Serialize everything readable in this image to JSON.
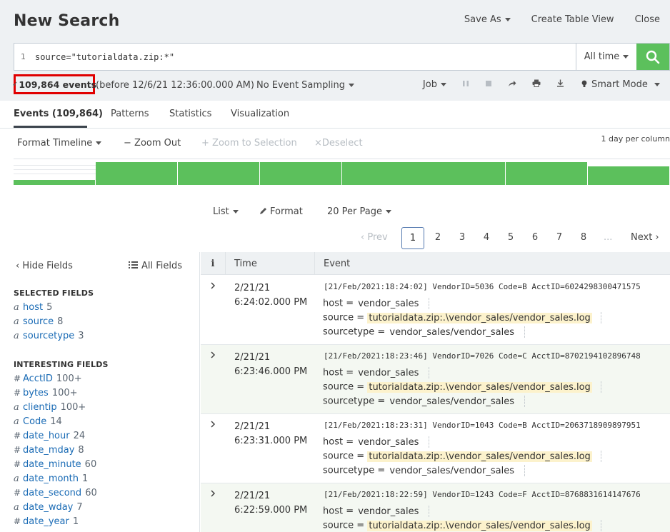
{
  "header": {
    "title": "New Search",
    "save_as": "Save As",
    "create_table_view": "Create Table View",
    "close": "Close"
  },
  "search": {
    "line_number": "1",
    "query": "source=\"tutorialdata.zip:*\"",
    "time_range": "All time"
  },
  "status": {
    "events_count": "109,864 events",
    "before": "(before 12/6/21 12:36:00.000 AM)",
    "sampling": "No Event Sampling",
    "job": "Job",
    "mode": "Smart Mode"
  },
  "tabs": {
    "events": "Events (109,864)",
    "patterns": "Patterns",
    "statistics": "Statistics",
    "visualization": "Visualization"
  },
  "timeline": {
    "format": "Format Timeline",
    "zoom_out": "Zoom Out",
    "zoom_selection": "Zoom to Selection",
    "deselect": "Deselect",
    "scale": "1 day per column",
    "bar_levels": [
      0.2,
      0.95,
      0.95,
      0.95,
      0.95,
      0.95,
      0.95,
      0.75
    ],
    "bar_color": "#5cc05c"
  },
  "list_controls": {
    "list": "List",
    "format": "Format",
    "per_page": "20 Per Page"
  },
  "pager": {
    "prev": "Prev",
    "pages": [
      "1",
      "2",
      "3",
      "4",
      "5",
      "6",
      "7",
      "8"
    ],
    "ellipsis": "...",
    "next": "Next"
  },
  "sidebar": {
    "hide_fields": "Hide Fields",
    "all_fields": "All Fields",
    "selected_heading": "SELECTED FIELDS",
    "selected": [
      {
        "type": "a",
        "name": "host",
        "count": "5"
      },
      {
        "type": "a",
        "name": "source",
        "count": "8"
      },
      {
        "type": "a",
        "name": "sourcetype",
        "count": "3"
      }
    ],
    "interesting_heading": "INTERESTING FIELDS",
    "interesting": [
      {
        "type": "#",
        "name": "AcctID",
        "count": "100+"
      },
      {
        "type": "#",
        "name": "bytes",
        "count": "100+"
      },
      {
        "type": "a",
        "name": "clientip",
        "count": "100+"
      },
      {
        "type": "a",
        "name": "Code",
        "count": "14"
      },
      {
        "type": "#",
        "name": "date_hour",
        "count": "24"
      },
      {
        "type": "#",
        "name": "date_mday",
        "count": "8"
      },
      {
        "type": "#",
        "name": "date_minute",
        "count": "60"
      },
      {
        "type": "a",
        "name": "date_month",
        "count": "1"
      },
      {
        "type": "#",
        "name": "date_second",
        "count": "60"
      },
      {
        "type": "a",
        "name": "date_wday",
        "count": "7"
      },
      {
        "type": "#",
        "name": "date_year",
        "count": "1"
      }
    ]
  },
  "table": {
    "col_info": "i",
    "col_time": "Time",
    "col_event": "Event"
  },
  "events": [
    {
      "date": "2/21/21",
      "time": "6:24:02.000 PM",
      "raw": "[21/Feb/2021:18:24:02] VendorID=5036 Code=B AcctID=6024298300471575",
      "host_label": "host =",
      "host": "vendor_sales",
      "source_label": "source =",
      "source": "tutorialdata.zip:.\\vendor_sales/vendor_sales.log",
      "sourcetype_label": "sourcetype =",
      "sourcetype": "vendor_sales/vendor_sales"
    },
    {
      "date": "2/21/21",
      "time": "6:23:46.000 PM",
      "raw": "[21/Feb/2021:18:23:46] VendorID=7026 Code=C AcctID=8702194102896748",
      "host_label": "host =",
      "host": "vendor_sales",
      "source_label": "source =",
      "source": "tutorialdata.zip:.\\vendor_sales/vendor_sales.log",
      "sourcetype_label": "sourcetype =",
      "sourcetype": "vendor_sales/vendor_sales"
    },
    {
      "date": "2/21/21",
      "time": "6:23:31.000 PM",
      "raw": "[21/Feb/2021:18:23:31] VendorID=1043 Code=B AcctID=2063718909897951",
      "host_label": "host =",
      "host": "vendor_sales",
      "source_label": "source =",
      "source": "tutorialdata.zip:.\\vendor_sales/vendor_sales.log",
      "sourcetype_label": "sourcetype =",
      "sourcetype": "vendor_sales/vendor_sales"
    },
    {
      "date": "2/21/21",
      "time": "6:22:59.000 PM",
      "raw": "[21/Feb/2021:18:22:59] VendorID=1243 Code=F AcctID=8768831614147676",
      "host_label": "host =",
      "host": "vendor_sales",
      "source_label": "source =",
      "source": "tutorialdata.zip:.\\vendor_sales/vendor_sales.log"
    }
  ]
}
